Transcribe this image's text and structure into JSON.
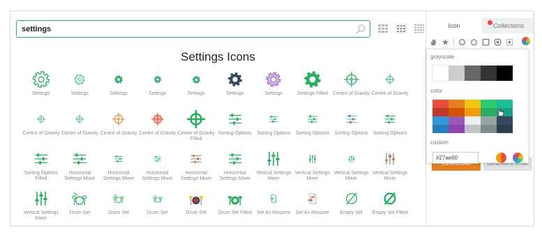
{
  "search": {
    "value": "settings",
    "placeholder": ""
  },
  "title": "Settings Icons",
  "view_buttons": [
    "grid-small-icon",
    "grid-medium-icon",
    "grid-large-icon"
  ],
  "icons": [
    {
      "label": "Settings",
      "type": "gear-outline",
      "color": "#27ae60",
      "size": 26
    },
    {
      "label": "Settings",
      "type": "gear-outline",
      "color": "#27ae60",
      "size": 16
    },
    {
      "label": "Settings",
      "type": "gear-solid-sm",
      "color": "#27ae60",
      "size": 14
    },
    {
      "label": "Settings",
      "type": "gear-solid-sm",
      "color": "#27ae60",
      "size": 12
    },
    {
      "label": "Settings",
      "type": "gear-solid-sm",
      "color": "#27ae60",
      "size": 13
    },
    {
      "label": "Settings",
      "type": "gear-solid",
      "color": "#34495e",
      "size": 22
    },
    {
      "label": "Settings",
      "type": "gear-purple",
      "color": "#9b59b6",
      "size": 22
    },
    {
      "label": "Settings Filled",
      "type": "gear-solid",
      "color": "#27ae60",
      "size": 26
    },
    {
      "label": "Centre of Gravity",
      "type": "crosshair",
      "color": "#27ae60",
      "size": 24
    },
    {
      "label": "Centre of Gravity",
      "type": "crosshair",
      "color": "#27ae60",
      "size": 16
    },
    {
      "label": "Centre of Gravity",
      "type": "crosshair-sm",
      "color": "#27ae60",
      "size": 14
    },
    {
      "label": "Centre of Gravity",
      "type": "crosshair-sm",
      "color": "#27ae60",
      "size": 14
    },
    {
      "label": "Centre of Gravity",
      "type": "crosshair",
      "color": "#e67e22",
      "size": 20
    },
    {
      "label": "Centre of Gravity",
      "type": "crosshair-arrows",
      "color": "#e74c3c",
      "size": 20
    },
    {
      "label": "Centre of Gravity Filled",
      "type": "crosshair-bold",
      "color": "#27ae60",
      "size": 26
    },
    {
      "label": "Sorting Options",
      "type": "sliders-h",
      "color": "#27ae60",
      "size": 22
    },
    {
      "label": "Sorting Options",
      "type": "sliders-h",
      "color": "#27ae60",
      "size": 14
    },
    {
      "label": "Sorting Options",
      "type": "sliders-h",
      "color": "#27ae60",
      "size": 16
    },
    {
      "label": "Sorting Options",
      "type": "sliders-h-blue",
      "color": "#3498db",
      "size": 18
    },
    {
      "label": "Sorting Options",
      "type": "sliders-h",
      "color": "#27ae60",
      "size": 18
    },
    {
      "label": "Sorting Options Filled",
      "type": "sliders-h",
      "color": "#27ae60",
      "size": 22
    },
    {
      "label": "Horizontal Settings Mixer",
      "type": "sliders-h",
      "color": "#27ae60",
      "size": 22
    },
    {
      "label": "Horizontal Settings Mixer",
      "type": "sliders-h",
      "color": "#27ae60",
      "size": 14
    },
    {
      "label": "Horizontal Settings Mixer",
      "type": "sliders-h",
      "color": "#27ae60",
      "size": 12
    },
    {
      "label": "Horizontal Settings Mixer",
      "type": "sliders-h-orange",
      "color": "#e67e22",
      "size": 18
    },
    {
      "label": "Horizontal Settings Mixer",
      "type": "sliders-h",
      "color": "#27ae60",
      "size": 22
    },
    {
      "label": "Vertical Settings Mixer",
      "type": "sliders-v",
      "color": "#27ae60",
      "size": 24
    },
    {
      "label": "Vertical Settings Mixer",
      "type": "sliders-v",
      "color": "#27ae60",
      "size": 14
    },
    {
      "label": "Vertical Settings Mixer",
      "type": "sliders-v",
      "color": "#27ae60",
      "size": 12
    },
    {
      "label": "Vertical Settings Mixer",
      "type": "sliders-v-orange",
      "color": "#e67e22",
      "size": 20
    },
    {
      "label": "Vertical Settings Mixer",
      "type": "sliders-v",
      "color": "#27ae60",
      "size": 24
    },
    {
      "label": "Drum Set",
      "type": "drum",
      "color": "#27ae60",
      "size": 22
    },
    {
      "label": "Drum Set",
      "type": "drum",
      "color": "#27ae60",
      "size": 16
    },
    {
      "label": "Drum Set",
      "type": "drum",
      "color": "#27ae60",
      "size": 14
    },
    {
      "label": "Drum Set",
      "type": "drum-color",
      "color": "#c0392b",
      "size": 22
    },
    {
      "label": "Drum Set Filled",
      "type": "drum-filled",
      "color": "#27ae60",
      "size": 22
    },
    {
      "label": "Set As Resume",
      "type": "doc-arrow",
      "color": "#27ae60",
      "size": 14
    },
    {
      "label": "Set As Resume",
      "type": "doc-color",
      "color": "#e74c3c",
      "size": 18
    },
    {
      "label": "Empty Set",
      "type": "empty-set",
      "color": "#27ae60",
      "size": 22
    },
    {
      "label": "Empty Set Filled",
      "type": "empty-set-bold",
      "color": "#27ae60",
      "size": 22
    }
  ],
  "panel": {
    "tab_icon": "Icon",
    "tab_collections": "Collections",
    "toolbar_icons": [
      "hand-icon",
      "star-icon",
      "circle-icon",
      "pentagon-icon",
      "square-icon",
      "square-round-icon",
      "crop-icon"
    ],
    "under_button_1": "DOWNLOAD",
    "under_button_2": "GENERATE HTML"
  },
  "popup": {
    "grayscale_label": "grayscale",
    "color_label": "color",
    "custom_label": "custom",
    "custom_value": "#27ae60",
    "grayscale": [
      "#ffffff",
      "#cccccc",
      "#666666",
      "#333333",
      "#000000"
    ],
    "colors": [
      "#e74c3c",
      "#e67e22",
      "#f1c40f",
      "#2ecc71",
      "#1abc9c",
      "#c0392b",
      "#d35400",
      "#f39c12",
      "#27ae60",
      "#16a085",
      "#3498db",
      "#9b59b6",
      "#ecf0f1",
      "#95a5a6",
      "#34495e",
      "#2980b9",
      "#8e44ad",
      "#bdc3c7",
      "#7f8c8d",
      "#2c3e50"
    ]
  }
}
